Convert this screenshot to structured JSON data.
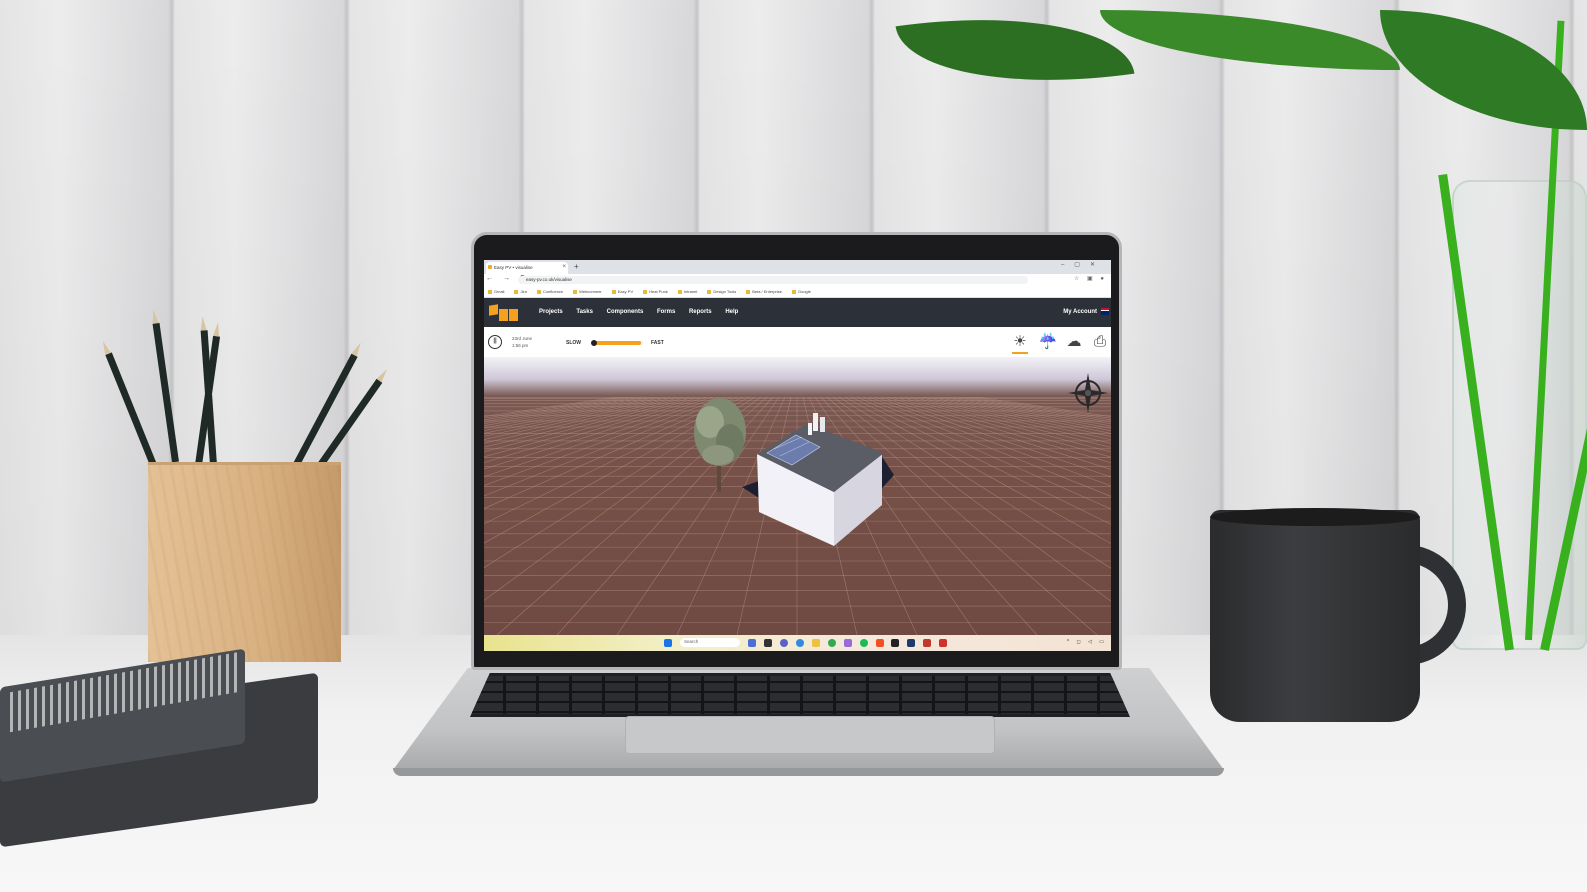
{
  "browser": {
    "tab_title": "Easy PV • visualise",
    "tab_close": "×",
    "new_tab": "+",
    "nav": "← → C",
    "url": "easy-pv.co.uk/visualise",
    "bookmarks": [
      "Gmail",
      "Jira",
      "Confluence",
      "Webcommer",
      "Easy PV",
      "Heat Punk",
      "Intranet",
      "Design Tools",
      "Beta / Enterprise",
      "Google"
    ]
  },
  "app": {
    "menu": [
      "Projects",
      "Tasks",
      "Components",
      "Forms",
      "Reports",
      "Help"
    ],
    "account": "My Account"
  },
  "simbar": {
    "date": "23rd June",
    "time": "1:56 pm",
    "slow": "SLOW",
    "fast": "FAST",
    "speed_fraction": 0.05,
    "weather_icons": [
      "sun-icon",
      "rain-icon",
      "cloud-icon",
      "camera-icon"
    ]
  },
  "taskbar": {
    "search_placeholder": "Search"
  },
  "colors": {
    "accent": "#f5a01e",
    "appbar": "#2c3038",
    "ground": "#765148"
  }
}
